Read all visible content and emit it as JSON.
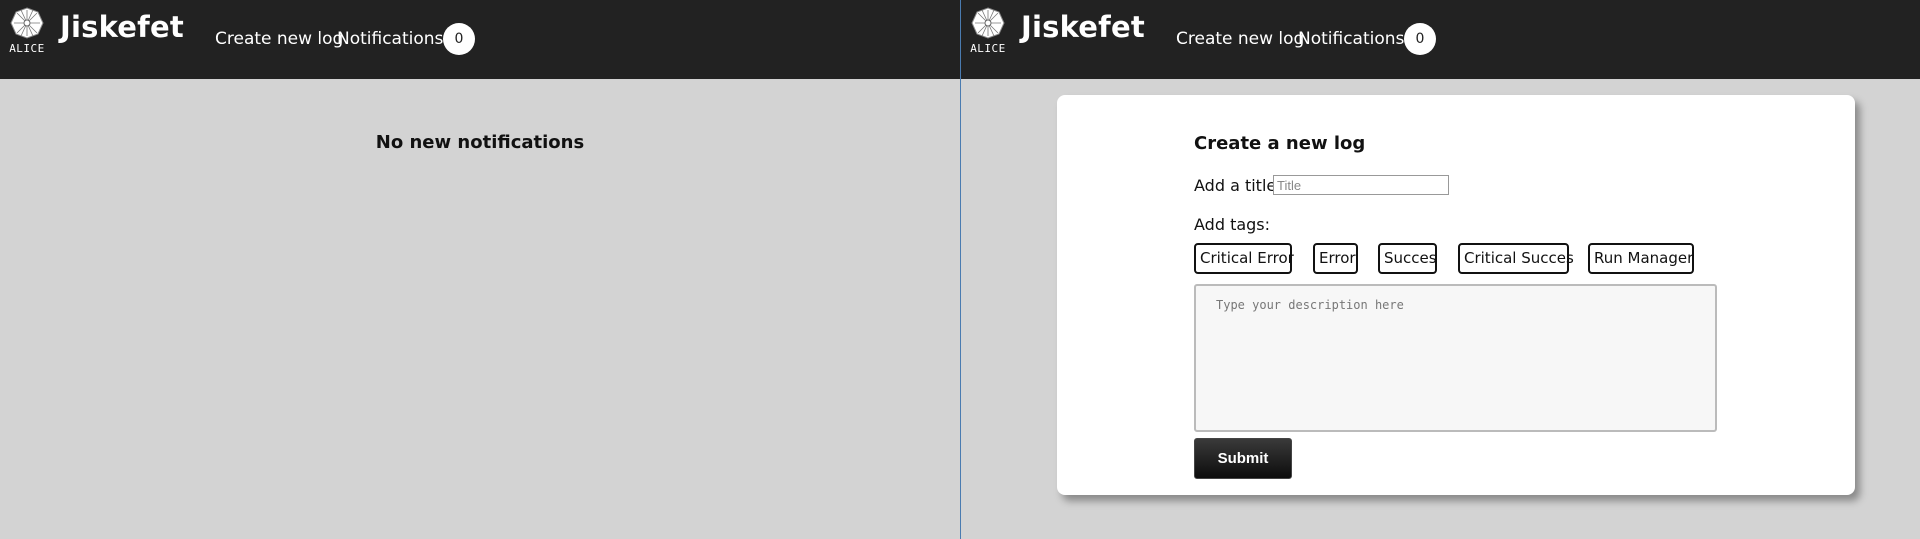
{
  "app": {
    "brand": "Jiskefet",
    "logo_text": "ALICE"
  },
  "nav": {
    "create_new_log": "Create new log",
    "notifications": "Notifications",
    "notification_count": "0"
  },
  "notifications_page": {
    "message": "No new notifications"
  },
  "create_log_form": {
    "heading": "Create a new log",
    "title_label": "Add a title:",
    "title_placeholder": "Title",
    "tags_label": "Add tags:",
    "tags": [
      "Critical Error",
      "Error",
      "Succes",
      "Critical Succes",
      "Run Manager"
    ],
    "description_placeholder": "Type your description here",
    "submit_label": "Submit"
  },
  "colors": {
    "navbar": "#222222",
    "page_background": "#d3d3d3",
    "card": "#ffffff"
  }
}
